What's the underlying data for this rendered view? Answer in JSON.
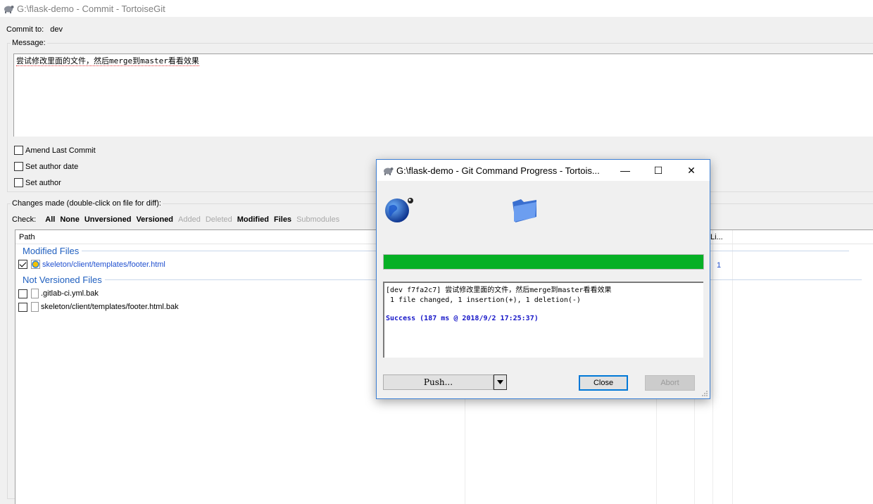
{
  "window": {
    "title": "G:\\flask-demo - Commit - TortoiseGit"
  },
  "commit": {
    "label": "Commit to:",
    "branch": "dev"
  },
  "message": {
    "legend": "Message:",
    "text": "尝试修改里面的文件，然后merge到master看看效果"
  },
  "options": {
    "amend": "Amend Last Commit",
    "author_date": "Set author date",
    "author": "Set author"
  },
  "changes": {
    "legend": "Changes made (double-click on file for diff):",
    "check_label": "Check:",
    "filters": [
      {
        "label": "All",
        "style": "bold"
      },
      {
        "label": "None",
        "style": "bold"
      },
      {
        "label": "Unversioned",
        "style": "bold"
      },
      {
        "label": "Versioned",
        "style": "bold"
      },
      {
        "label": "Added",
        "style": "gray"
      },
      {
        "label": "Deleted",
        "style": "gray"
      },
      {
        "label": "Modified",
        "style": "bold"
      },
      {
        "label": "Files",
        "style": "bold"
      },
      {
        "label": "Submodules",
        "style": "gray"
      }
    ],
    "columns": {
      "path": "Path",
      "lines": "Li..."
    },
    "groups": {
      "modified": {
        "title": "Modified Files",
        "files": [
          {
            "path": "skeleton/client/templates/footer.html",
            "lines": "1",
            "checked": true
          }
        ]
      },
      "unversioned": {
        "title": "Not Versioned Files",
        "files": [
          {
            "path": ".gitlab-ci.yml.bak",
            "checked": false
          },
          {
            "path": "skeleton/client/templates/footer.html.bak",
            "checked": false
          }
        ]
      }
    }
  },
  "progress_dialog": {
    "title": "G:\\flask-demo - Git Command Progress - Tortois...",
    "progress_percent": 100,
    "progress_color": "#06b025",
    "log": {
      "line1": "[dev f7fa2c7] 尝试修改里面的文件，然后merge到master看看效果",
      "line2": " 1 file changed, 1 insertion(+), 1 deletion(-)",
      "success": "Success (187 ms @ 2018/9/2 17:25:37)"
    },
    "buttons": {
      "push": "Push...",
      "close": "Close",
      "abort": "Abort"
    },
    "window_controls": {
      "minimize": "—",
      "maximize": "☐",
      "close": "✕"
    }
  }
}
